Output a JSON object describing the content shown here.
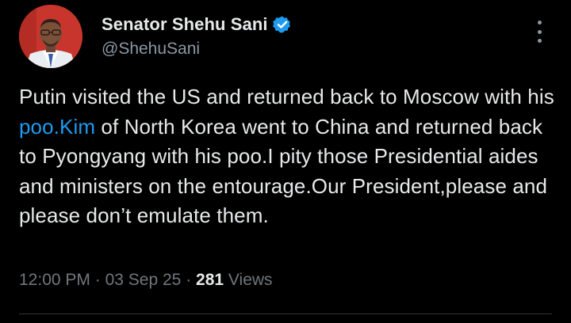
{
  "author": {
    "display_name": "Senator Shehu Sani",
    "handle": "@ShehuSani",
    "verified": true
  },
  "tweet": {
    "text_before_link": "Putin visited the US and returned back to Moscow with his ",
    "link_text": "poo.Kim",
    "text_after_link": " of North Korea went to China and returned back to Pyongyang with his poo.I pity those Presidential aides and ministers on the entourage.Our President,please and please don’t emulate them."
  },
  "meta": {
    "time": "12:00 PM",
    "separator": "·",
    "date": "03 Sep 25",
    "views_count": "281",
    "views_label": "Views"
  },
  "colors": {
    "background": "#000000",
    "text": "#e7e9ea",
    "secondary": "#71767b",
    "link": "#1d9bf0",
    "verified_badge": "#1d9bf0"
  },
  "icons": {
    "verified": "verified-badge-icon",
    "more": "more-options-icon"
  }
}
